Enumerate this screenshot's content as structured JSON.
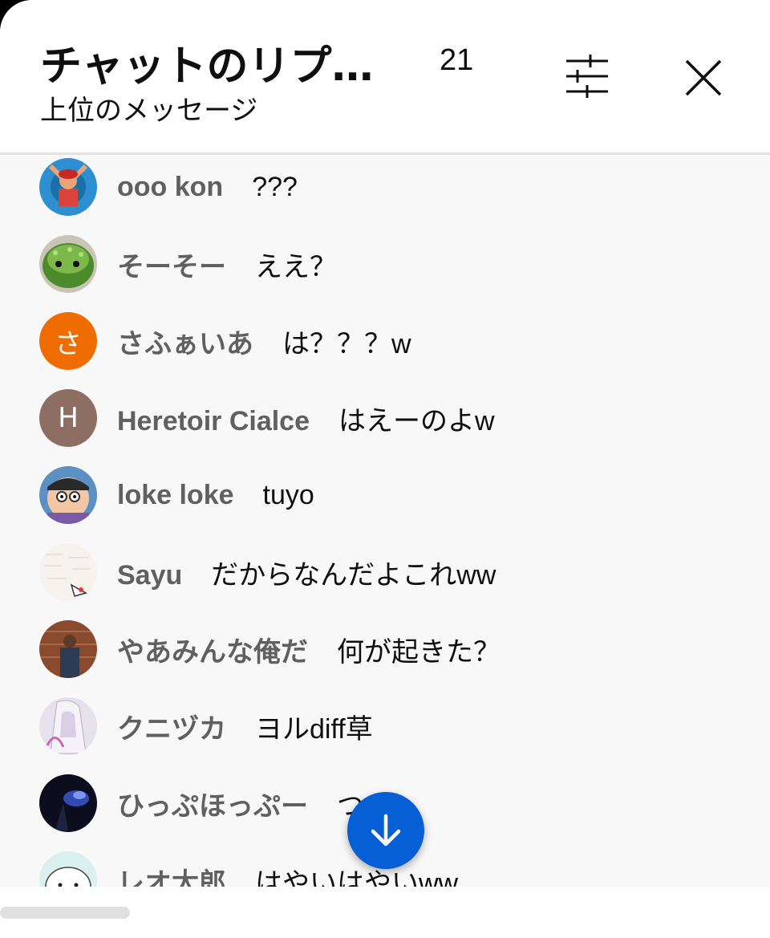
{
  "header": {
    "title": "チャットのリプ…",
    "viewer_count": "21",
    "subtitle": "上位のメッセージ",
    "filter_icon": "sliders-icon",
    "close_icon": "close-icon"
  },
  "messages": [
    {
      "author": "ooo kon",
      "text": "???",
      "avatar": "photo-swimmer"
    },
    {
      "author": "そーそー",
      "text": "ええ？",
      "avatar": "photo-green-creature"
    },
    {
      "author": "さふぁいあ",
      "text": "は？？？w",
      "avatar_letter": "さ",
      "avatar_color": "#ef6c00"
    },
    {
      "author": "Heretoir Cialce",
      "text": "はえーのよw",
      "avatar_letter": "H",
      "avatar_color": "#8d6e63"
    },
    {
      "author": "loke loke",
      "text": "tuyo",
      "avatar": "photo-cartoon-face"
    },
    {
      "author": "Sayu",
      "text": "だからなんだよこれww",
      "avatar": "photo-sketch"
    },
    {
      "author": "やあみんな俺だ",
      "text": "何が起きた？",
      "avatar": "photo-person-brick"
    },
    {
      "author": "クニヅカ",
      "text": "ヨルdiff草",
      "avatar": "photo-anime-white"
    },
    {
      "author": "ひっぷほっぷー",
      "text": "つよ",
      "avatar": "photo-dark-blue"
    },
    {
      "author": "レオ太郎",
      "text": "はやいはやいww",
      "avatar": "photo-cat-drawing"
    }
  ],
  "scroll_down_icon": "arrow-down-icon",
  "colors": {
    "accent": "#065fd4",
    "author_text": "#606060",
    "list_bg": "#f8f8f8"
  }
}
